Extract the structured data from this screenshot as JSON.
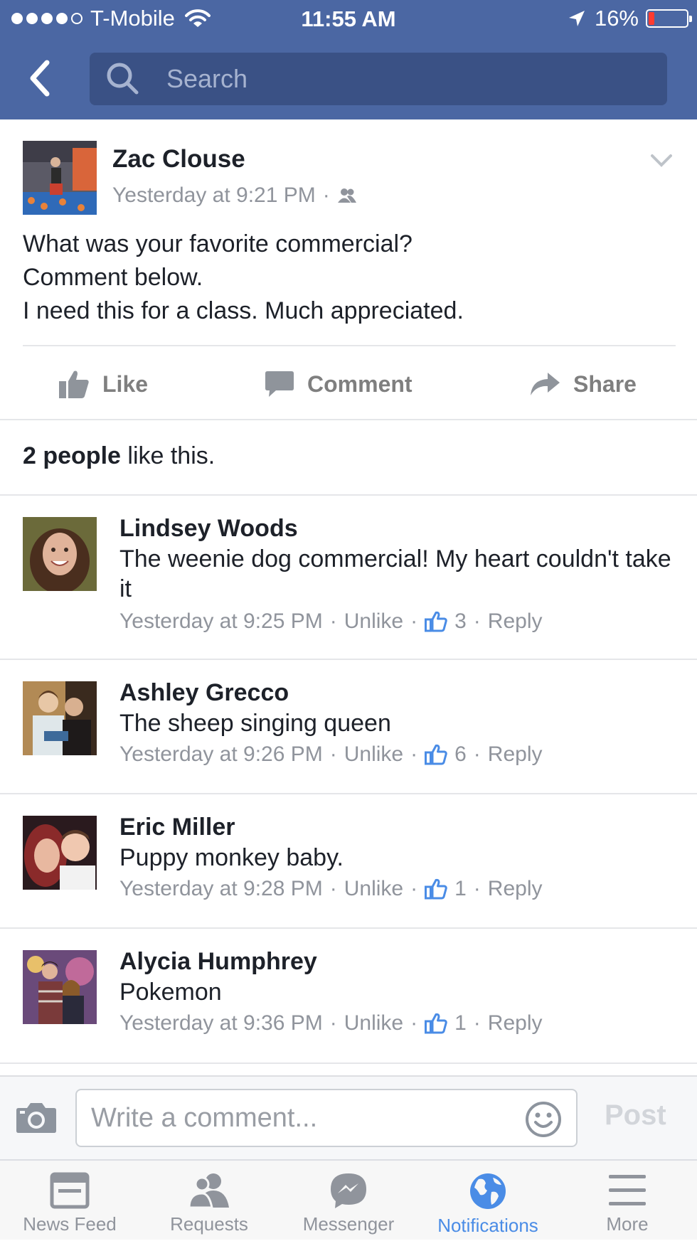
{
  "status_bar": {
    "carrier": "T-Mobile",
    "time": "11:55 AM",
    "battery": "16%",
    "battery_level": 0.16
  },
  "search": {
    "placeholder": "Search"
  },
  "post": {
    "author": "Zac Clouse",
    "timestamp": "Yesterday at 9:21 PM",
    "audience_separator": "·",
    "audience_icon": "friends-icon",
    "text_lines": [
      "What was your favorite commercial?",
      "Comment below.",
      "I need this for a class. Much appreciated."
    ],
    "actions": {
      "like": "Like",
      "comment": "Comment",
      "share": "Share"
    }
  },
  "likes": {
    "count_text": "2 people",
    "suffix": " like this."
  },
  "comments": [
    {
      "name": "Lindsey Woods",
      "text": "The weenie dog commercial! My heart couldn't take it",
      "time": "Yesterday at 9:25 PM",
      "unlike": "Unlike",
      "likes": "3",
      "reply": "Reply"
    },
    {
      "name": "Ashley Grecco",
      "text": "The sheep singing queen",
      "time": "Yesterday at 9:26 PM",
      "unlike": "Unlike",
      "likes": "6",
      "reply": "Reply"
    },
    {
      "name": "Eric Miller",
      "text": "Puppy monkey baby.",
      "time": "Yesterday at 9:28 PM",
      "unlike": "Unlike",
      "likes": "1",
      "reply": "Reply"
    },
    {
      "name": "Alycia Humphrey",
      "text": "Pokemon",
      "time": "Yesterday at 9:36 PM",
      "unlike": "Unlike",
      "likes": "1",
      "reply": "Reply"
    }
  ],
  "composer": {
    "placeholder": "Write a comment...",
    "post_label": "Post"
  },
  "tabs": [
    {
      "label": "News Feed",
      "icon": "news-feed-icon"
    },
    {
      "label": "Requests",
      "icon": "requests-icon"
    },
    {
      "label": "Messenger",
      "icon": "messenger-icon"
    },
    {
      "label": "Notifications",
      "icon": "globe-icon",
      "active": true
    },
    {
      "label": "More",
      "icon": "menu-icon"
    }
  ],
  "colors": {
    "header": "#4b67a3",
    "search_bg": "#3a5185",
    "active_tab": "#4a8ce6",
    "like_blue": "#4a8ce6",
    "battery_low": "#ff3b30"
  }
}
